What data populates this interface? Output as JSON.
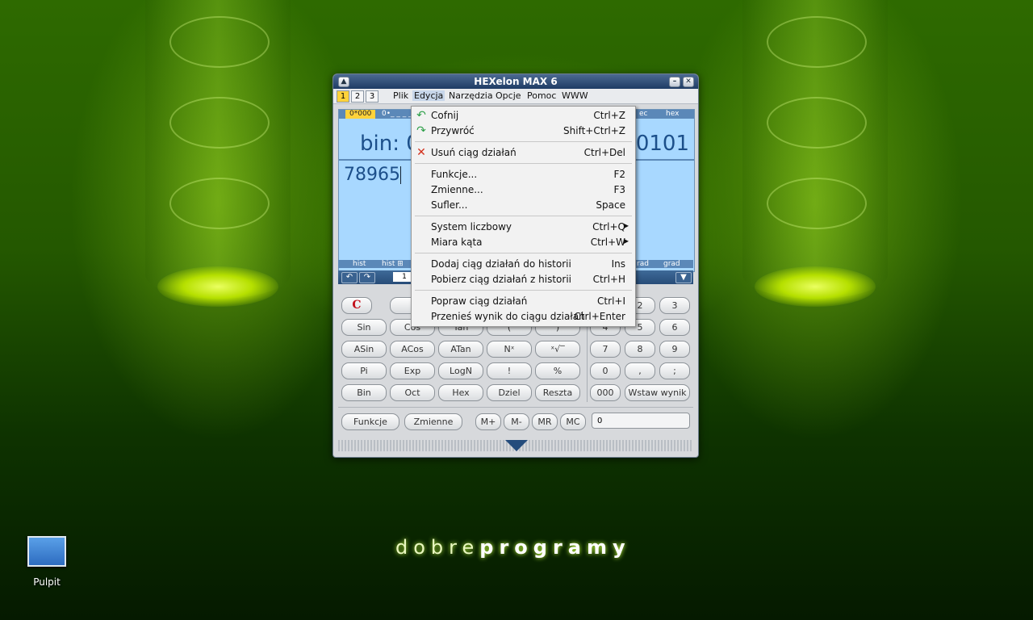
{
  "desktop": {
    "icon_label": "Pulpit",
    "brand_light": "dobre",
    "brand_bold": "programy"
  },
  "window": {
    "title": "HEXelon MAX 6",
    "presets": [
      "1",
      "2",
      "3"
    ],
    "menu": [
      "Plik",
      "Edycja",
      "Narzędzia",
      "Opcje",
      "Pomoc",
      "WWW"
    ],
    "display": {
      "sys_left": [
        "0*000",
        "0•_ _ _ _"
      ],
      "sys_right": [
        "ec",
        "hex"
      ],
      "big_left": "bin: 0",
      "big_right": "0101",
      "input": "78965",
      "bottom_left": [
        "hist",
        "hist ⊞"
      ],
      "bottom_right": [
        "rad",
        "grad"
      ]
    },
    "toolstrip_field": "1",
    "keys": {
      "clear": "C",
      "row2": [
        "Sin",
        "Cos",
        "Tan",
        "(",
        ")"
      ],
      "row3": [
        "ASin",
        "ACos",
        "ATan",
        "Nˣ",
        "ˣ√‾"
      ],
      "row4": [
        "Pi",
        "Exp",
        "LogN",
        "!",
        "%"
      ],
      "row5": [
        "Bin",
        "Oct",
        "Hex",
        "Dziel",
        "Reszta"
      ],
      "num_row1": [
        "2",
        "3"
      ],
      "num_row2": [
        "4",
        "5",
        "6"
      ],
      "num_row3": [
        "7",
        "8",
        "9"
      ],
      "num_row4": [
        "0",
        ",",
        ";"
      ],
      "num_row5": [
        "000",
        "Wstaw wynik"
      ]
    },
    "bottom": {
      "functions": "Funkcje",
      "variables": "Zmienne",
      "mem": [
        "M+",
        "M-",
        "MR",
        "MC"
      ],
      "mem_value": "0"
    }
  },
  "edit_menu": {
    "items": [
      {
        "label": "Cofnij",
        "shortcut": "Ctrl+Z",
        "icon": "undo-icon"
      },
      {
        "label": "Przywróć",
        "shortcut": "Shift+Ctrl+Z",
        "icon": "redo-icon"
      },
      {
        "label": "Usuń ciąg działań",
        "shortcut": "Ctrl+Del",
        "icon": "delete-icon"
      },
      {
        "label": "Funkcje...",
        "shortcut": "F2"
      },
      {
        "label": "Zmienne...",
        "shortcut": "F3"
      },
      {
        "label": "Sufler...",
        "shortcut": "Space"
      },
      {
        "label": "System liczbowy",
        "shortcut": "Ctrl+Q"
      },
      {
        "label": "Miara kąta",
        "shortcut": "Ctrl+W"
      },
      {
        "label": "Dodaj ciąg działań do historii",
        "shortcut": "Ins"
      },
      {
        "label": "Pobierz ciąg działań z historii",
        "shortcut": "Ctrl+H"
      },
      {
        "label": "Popraw ciąg działań",
        "shortcut": "Ctrl+I"
      },
      {
        "label": "Przenieś wynik do ciągu działań",
        "shortcut": "Ctrl+Enter"
      }
    ]
  }
}
